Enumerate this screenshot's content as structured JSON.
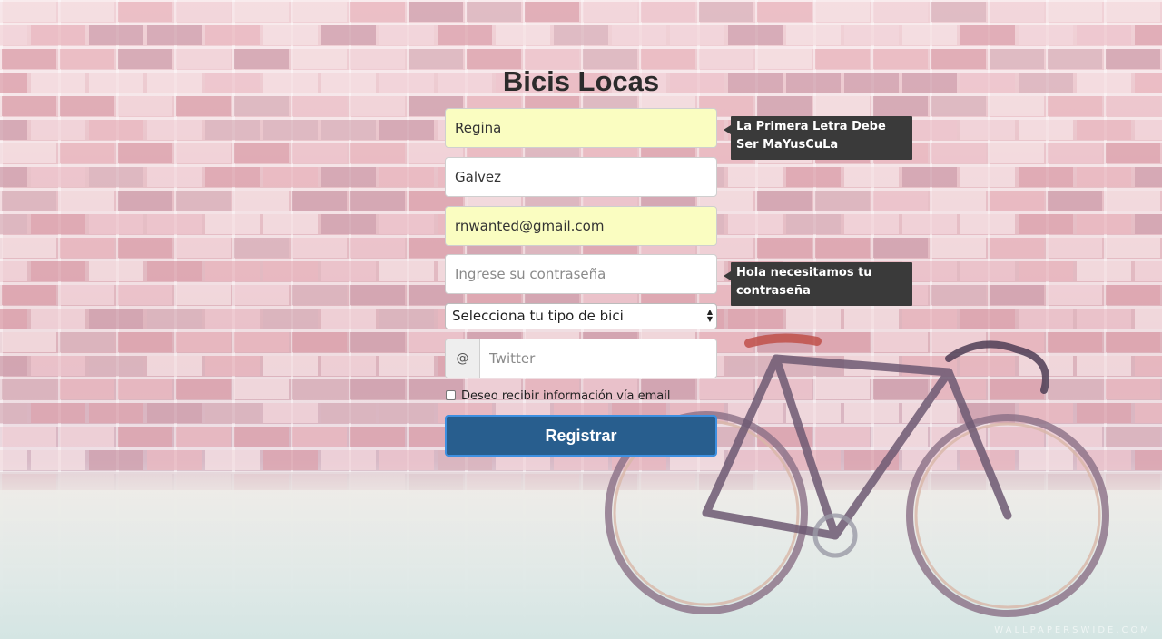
{
  "page": {
    "title": "Bicis Locas",
    "watermark": "WALLPAPERSWIDE.COM"
  },
  "form": {
    "first_name": {
      "value": "Regina",
      "autofilled": true
    },
    "last_name": {
      "value": "Galvez"
    },
    "email": {
      "value": "rnwanted@gmail.com",
      "autofilled": true
    },
    "password": {
      "value": "",
      "placeholder": "Ingrese su contraseña"
    },
    "bike_type": {
      "selected": "Selecciona tu tipo de bici"
    },
    "twitter": {
      "addon": "@",
      "value": "",
      "placeholder": "Twitter"
    },
    "newsletter": {
      "label": "Deseo recibir información vía email",
      "checked": false
    },
    "submit_label": "Registrar"
  },
  "tooltips": {
    "first_name": "La Primera Letra Debe Ser MaYusCuLa",
    "password": "Hola necesitamos tu contraseña"
  },
  "colors": {
    "button_bg": "#285e8e",
    "button_border": "#3d8fe0",
    "autofill_bg": "#fafdc1",
    "tooltip_bg": "#3a3a3a"
  }
}
